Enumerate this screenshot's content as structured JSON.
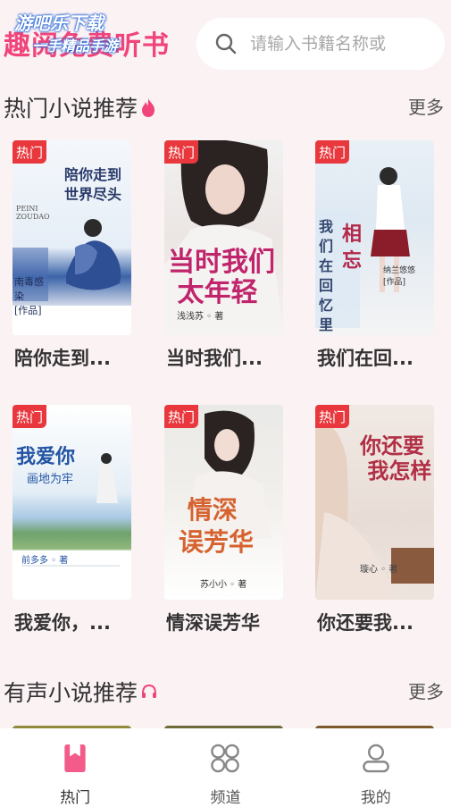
{
  "header": {
    "app_title": "趣阅免费听书",
    "watermark_line1": "游吧乐下载",
    "watermark_line2": "一手精品手游"
  },
  "search": {
    "placeholder": "请输入书籍名称或"
  },
  "hot_section": {
    "title": "热门小说推荐",
    "more": "更多",
    "badge": "热门",
    "books": [
      {
        "title": "陪你走到...",
        "cover_title": "陪你走到世界尽头",
        "cover_sub": "PEINI ZOUDAO",
        "cover_author": "南毒感染 [作品]"
      },
      {
        "title": "当时我们...",
        "cover_title": "当时我们太年轻",
        "cover_author": "浅浅苏 著"
      },
      {
        "title": "我们在回...",
        "cover_title": "我们在回忆里 相忘",
        "cover_author": "纳兰悠悠 [作品]"
      },
      {
        "title": "我爱你，...",
        "cover_title": "我爱你画地为牢",
        "cover_author": "前多多 著"
      },
      {
        "title": "情深误芳华",
        "cover_title": "情深误芳华",
        "cover_author": "苏小小 著"
      },
      {
        "title": "你还要我...",
        "cover_title": "你还要我怎样",
        "cover_author": "璇心 著"
      }
    ]
  },
  "audio_section": {
    "title": "有声小说推荐",
    "more": "更多"
  },
  "nav": {
    "items": [
      {
        "label": "热门",
        "icon": "bookmark-icon",
        "active": true
      },
      {
        "label": "频道",
        "icon": "grid-icon",
        "active": false
      },
      {
        "label": "我的",
        "icon": "user-icon",
        "active": false
      }
    ]
  },
  "colors": {
    "accent": "#f0447a",
    "badge": "#e8383d",
    "background": "#fbf2f4"
  }
}
